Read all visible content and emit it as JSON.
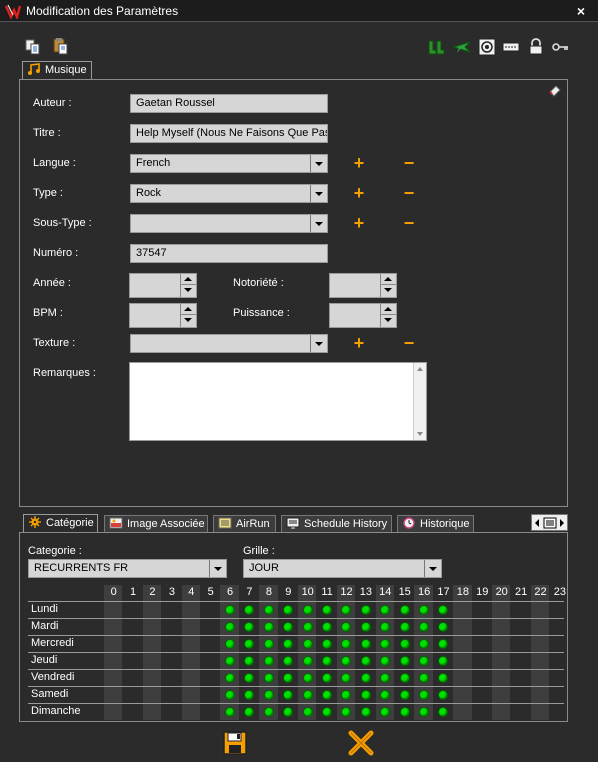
{
  "window": {
    "title": "Modification des Paramètres",
    "close_label": "×"
  },
  "toolbar": {
    "left_icons": [
      "copy-icon",
      "paste-icon"
    ],
    "right_icons": [
      "boots-icon",
      "airplane-icon",
      "target-icon",
      "ticket-icon",
      "lock-icon",
      "key-icon"
    ]
  },
  "main_tab": {
    "label": "Musique"
  },
  "form": {
    "auteur": {
      "label": "Auteur :",
      "value": "Gaetan Roussel"
    },
    "titre": {
      "label": "Titre :",
      "value": "Help Myself (Nous Ne Faisons Que Pas"
    },
    "langue": {
      "label": "Langue :",
      "value": "French"
    },
    "type": {
      "label": "Type :",
      "value": "Rock"
    },
    "sous_type": {
      "label": "Sous-Type :",
      "value": ""
    },
    "numero": {
      "label": "Numéro :",
      "value": "37547"
    },
    "annee": {
      "label": "Année :",
      "value": ""
    },
    "notoriete": {
      "label": "Notoriété :",
      "value": ""
    },
    "bpm": {
      "label": "BPM :",
      "value": ""
    },
    "puissance": {
      "label": "Puissance :",
      "value": ""
    },
    "texture": {
      "label": "Texture :",
      "value": ""
    },
    "remarques": {
      "label": "Remarques :",
      "value": ""
    },
    "plus_glyph": "+",
    "minus_glyph": "−"
  },
  "bottom_tabs": [
    {
      "label": "Catégorie",
      "icon": "gear-icon",
      "active": true
    },
    {
      "label": "Image Associée",
      "icon": "image-icon",
      "active": false
    },
    {
      "label": "AirRun",
      "icon": "document-icon",
      "active": false
    },
    {
      "label": "Schedule History",
      "icon": "monitor-icon",
      "active": false
    },
    {
      "label": "Historique",
      "icon": "clock-icon",
      "active": false
    }
  ],
  "category_panel": {
    "categorie_label": "Categorie :",
    "categorie_value": "RECURRENTS FR",
    "grille_label": "Grille :",
    "grille_value": "JOUR",
    "hours": [
      "0",
      "1",
      "2",
      "3",
      "4",
      "5",
      "6",
      "7",
      "8",
      "9",
      "10",
      "11",
      "12",
      "13",
      "14",
      "15",
      "16",
      "17",
      "18",
      "19",
      "20",
      "21",
      "22",
      "23"
    ],
    "days": [
      "Lundi",
      "Mardi",
      "Mercredi",
      "Jeudi",
      "Vendredi",
      "Samedi",
      "Dimanche"
    ],
    "active_hours": [
      6,
      7,
      8,
      9,
      10,
      11,
      12,
      13,
      14,
      15,
      16,
      17
    ]
  },
  "footer": {
    "save_icon": "floppy-save-icon",
    "cancel_icon": "cancel-x-icon"
  }
}
